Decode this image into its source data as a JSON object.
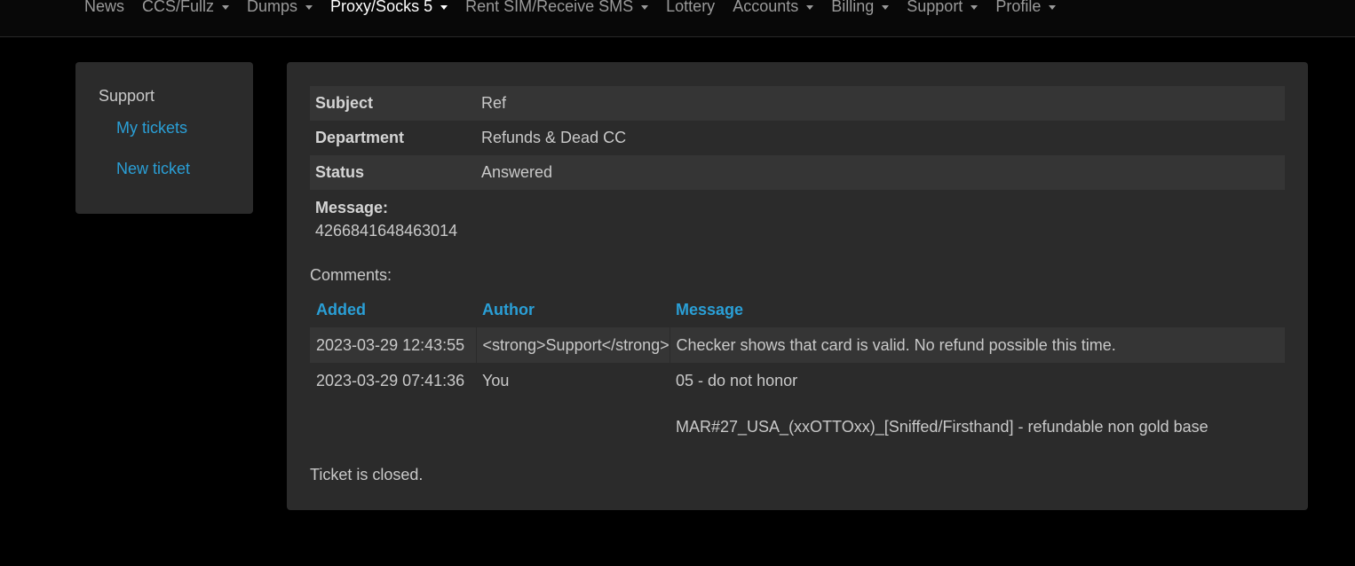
{
  "nav": {
    "items": [
      {
        "label": "News",
        "dropdown": false,
        "active": false
      },
      {
        "label": "CCS/Fullz",
        "dropdown": true,
        "active": false
      },
      {
        "label": "Dumps",
        "dropdown": true,
        "active": false
      },
      {
        "label": "Proxy/Socks 5",
        "dropdown": true,
        "active": true
      },
      {
        "label": "Rent SIM/Receive SMS",
        "dropdown": true,
        "active": false
      },
      {
        "label": "Lottery",
        "dropdown": false,
        "active": false
      },
      {
        "label": "Accounts",
        "dropdown": true,
        "active": false
      },
      {
        "label": "Billing",
        "dropdown": true,
        "active": false
      },
      {
        "label": "Support",
        "dropdown": true,
        "active": false
      },
      {
        "label": "Profile",
        "dropdown": true,
        "active": false
      }
    ]
  },
  "sidebar": {
    "heading": "Support",
    "links": [
      "My tickets",
      "New ticket"
    ]
  },
  "ticket": {
    "subject_label": "Subject",
    "subject": "Ref",
    "department_label": "Department",
    "department": "Refunds & Dead CC",
    "status_label": "Status",
    "status": "Answered",
    "message_label": "Message:",
    "message": "4266841648463014",
    "comments_label": "Comments:",
    "closed_note": "Ticket is closed."
  },
  "comments": {
    "headers": {
      "added": "Added",
      "author": "Author",
      "message": "Message"
    },
    "rows": [
      {
        "added": "2023-03-29 12:43:55",
        "author": "<strong>Support</strong>",
        "message_line1": "Checker shows that card is valid. No refund possible this time.",
        "message_line2": ""
      },
      {
        "added": "2023-03-29 07:41:36",
        "author": "You",
        "message_line1": "05 - do not honor",
        "message_line2": "MAR#27_USA_(xxOTTOxx)_[Sniffed/Firsthand] - refundable non gold base"
      }
    ]
  },
  "colors": {
    "background": "#000000",
    "panel": "#2b2b2b",
    "stripe": "#353535",
    "link": "#2a9fd6",
    "text": "#c9c9c9"
  }
}
